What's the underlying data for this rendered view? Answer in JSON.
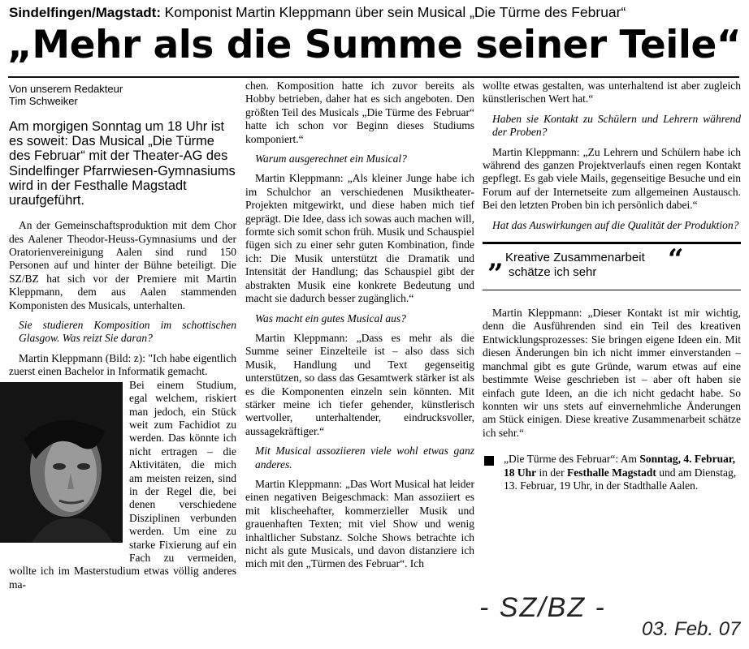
{
  "kicker": {
    "location": "Sindelfingen/Magstadt:",
    "topic": "Komponist Martin Kleppmann über sein Musical „Die Türme des Februar“"
  },
  "headline": "„Mehr als die Summe seiner Teile“",
  "byline": {
    "line1": "Von unserem Redakteur",
    "line2": "Tim Schweiker"
  },
  "lead": "Am morgigen Sonntag um 18 Uhr ist es soweit: Das Musical „Die Türme des Februar“ mit der Theater-AG des Sindelfinger Pfarrwiesen-Gymnasiums wird in der Festhalle Magstadt uraufgeführt.",
  "column1": {
    "p1": "An der Gemeinschaftsproduktion mit dem Chor des Aalener Theodor-Heuss-Gymnasiums und der Oratorienvereinigung Aalen sind rund 150 Personen auf und hinter der Bühne beteiligt. Die SZ/BZ hat sich vor der Premiere mit Martin Kleppmann, dem aus Aalen stammenden Komponisten des Musicals, unterhalten.",
    "q1": "Sie studieren Komposition im schottischen Glasgow. Was reizt Sie daran?",
    "a1_start": "Martin Kleppmann (Bild: z): \"Ich habe eigentlich zuerst einen Bachelor in Informatik gemacht.",
    "a1_rest": "Bei einem Studium, egal welchem, riskiert man jedoch, ein Stück weit zum Fachidiot zu werden. Das könnte ich nicht ertragen – die Aktivitäten, die mich am meisten reizen, sind in der Regel die, bei denen verschiedene Disziplinen verbunden werden. Um eine zu starke Fixierung auf ein Fach zu vermeiden, wollte ich im Masterstudium etwas völlig anderes ma-"
  },
  "column2": {
    "p1": "chen. Komposition hatte ich zuvor bereits als Hobby betrieben, daher hat es sich angeboten. Den größten Teil des Musicals „Die Türme des Februar“ hatte ich schon vor Beginn dieses Studiums komponiert.“",
    "q1": "Warum ausgerechnet ein Musical?",
    "a1": "Martin Kleppmann: „Als kleiner Junge habe ich im Schulchor an verschiedenen Musiktheater-Projekten mitgewirkt, und diese haben mich tief geprägt. Die Idee, dass ich sowas auch machen will, formte sich somit schon früh. Musik und Schauspiel fügen sich zu einer sehr guten Kombination, finde ich: Die Musik unterstützt die Dramatik und Intensität der Handlung; das Schauspiel gibt der abstrakten Musik eine konkrete Bedeutung und macht sie dadurch besser zugänglich.“",
    "q2": "Was macht ein gutes Musical aus?",
    "a2": "Martin Kleppmann: „Dass es mehr als die Summe seiner Einzelteile ist – also dass sich Musik, Handlung und Text gegenseitig unterstützen, so dass das Gesamtwerk stärker ist als es die Komponenten einzeln sein könnten. Mit stärker meine ich tiefer gehender, künstlerisch wertvoller, unterhaltender, eindrucksvoller, aussagekräftiger.“",
    "q3": "Mit Musical assoziieren viele wohl etwas ganz anderes.",
    "a3": "Martin Kleppmann: „Das Wort Musical hat leider einen negativen Beigeschmack: Man assoziiert es mit klischeehafter, kommerzieller Musik und grauenhaften Texten; mit viel Show und wenig inhaltlicher Substanz. Solche Shows betrachte ich nicht als gute Musicals, und davon distanziere ich mich mit den „Türmen des Februar“. Ich"
  },
  "column3": {
    "p1": "wollte etwas gestalten, was unterhaltend ist aber zugleich künstlerischen Wert hat.“",
    "q1": "Haben sie Kontakt zu Schülern und Lehrern während der Proben?",
    "a1": "Martin Kleppmann: „Zu Lehrern und Schülern habe ich während des ganzen Projektverlaufs einen regen Kontakt gepflegt. Es gab viele Mails, gegenseitige Besuche und ein Forum auf der Internetseite zum allgemeinen Austausch. Bei den letzten Proben bin ich persönlich dabei.“",
    "q2": "Hat das Auswirkungen auf die Qualität der Produktion?",
    "pullquote_line1": "Kreative Zusammenarbeit",
    "pullquote_line2": "schätze ich sehr",
    "a2": "Martin Kleppmann: „Dieser Kontakt ist mir wichtig, denn die Ausführenden sind ein Teil des kreativen Entwicklungsprozesses: Sie bringen eigene Ideen ein. Mit diesen Änderungen bin ich nicht immer einverstanden – manchmal gibt es gute Gründe, warum etwas auf eine bestimmte Weise geschrieben ist – aber oft haben sie einfach gute Ideen, an die ich nicht gedacht habe. So konnten wir uns stets auf einvernehmliche Änderungen am Stück einigen. Diese kreative Zusammenarbeit schätze ich sehr.“",
    "info_title": "„Die Türme des Februar“:",
    "info_am": "Am",
    "info_date1": "Sonntag, 4. Februar, 18 Uhr",
    "info_in": "in der",
    "info_venue1": "Festhalle Magstadt",
    "info_rest": "und am Dienstag, 13. Februar, 19 Uhr, in der Stadthalle Aalen."
  },
  "handwriting": {
    "source": "- SZ/BZ -",
    "date": "03. Feb. 07"
  }
}
